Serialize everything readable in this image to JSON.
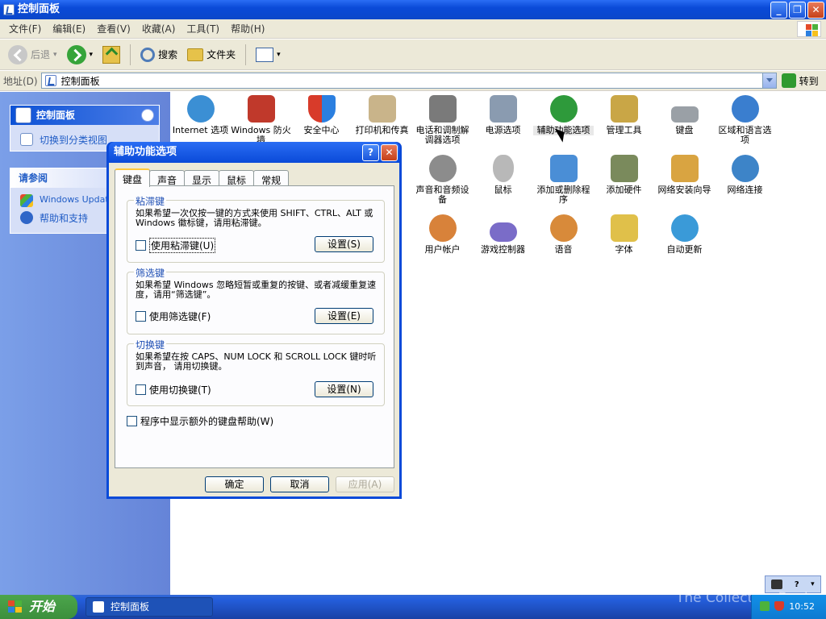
{
  "window": {
    "title": "控制面板"
  },
  "menu": [
    "文件(F)",
    "编辑(E)",
    "查看(V)",
    "收藏(A)",
    "工具(T)",
    "帮助(H)"
  ],
  "toolbar": {
    "back": "后退",
    "search": "搜索",
    "folders": "文件夹"
  },
  "address": {
    "label": "地址(D)",
    "value": "控制面板",
    "go": "转到"
  },
  "sidebar": {
    "panel1": {
      "title": "控制面板",
      "link": "切换到分类视图"
    },
    "panel2": {
      "title": "请参阅",
      "links": [
        "Windows Update",
        "帮助和支持"
      ]
    }
  },
  "icons": [
    {
      "label": "Internet 选项",
      "color": "#3b8fd4"
    },
    {
      "label": "Windows 防火墙",
      "color": "#c0392b"
    },
    {
      "label": "安全中心",
      "color": "#d83b2a"
    },
    {
      "label": "打印机和传真",
      "color": "#c9b48a"
    },
    {
      "label": "电话和调制解调器选项",
      "color": "#7a7a7a"
    },
    {
      "label": "电源选项",
      "color": "#8a9bb0"
    },
    {
      "label": "辅助功能选项",
      "color": "#2e9a3b"
    },
    {
      "label": "管理工具",
      "color": "#c9a646"
    },
    {
      "label": "键盘",
      "color": "#9aa0a6"
    },
    {
      "label": "区域和语言选项",
      "color": "#3a7ecf"
    },
    {
      "label": "声音和音频设备",
      "color": "#8c8c8c"
    },
    {
      "label": "鼠标",
      "color": "#b8b8b8"
    },
    {
      "label": "添加或删除程序",
      "color": "#4a8ed6"
    },
    {
      "label": "添加硬件",
      "color": "#7a8a5c"
    },
    {
      "label": "网络安装向导",
      "color": "#d9a441"
    },
    {
      "label": "网络连接",
      "color": "#3d84c8"
    },
    {
      "label": "用户帐户",
      "color": "#d8823a"
    },
    {
      "label": "游戏控制器",
      "color": "#7a6cc8"
    },
    {
      "label": "语音",
      "color": "#d88a3a"
    },
    {
      "label": "字体",
      "color": "#e0c04a"
    },
    {
      "label": "自动更新",
      "color": "#3a9ad8"
    }
  ],
  "dialog": {
    "title": "辅助功能选项",
    "tabs": [
      "键盘",
      "声音",
      "显示",
      "鼠标",
      "常规"
    ],
    "groups": [
      {
        "title": "粘滞键",
        "text": "如果希望一次仅按一键的方式来使用 SHIFT、CTRL、ALT 或 Windows 徽标键，请用粘滞键。",
        "check": "使用粘滞键(U)",
        "button": "设置(S)"
      },
      {
        "title": "筛选键",
        "text": "如果希望 Windows 忽略短暂或重复的按键、或者减缓重复速度，请用“筛选键”。",
        "check": "使用筛选键(F)",
        "button": "设置(E)"
      },
      {
        "title": "切换键",
        "text": "如果希望在按 CAPS、NUM LOCK 和 SCROLL LOCK 键时听到声音， 请用切换键。",
        "check": "使用切换键(T)",
        "button": "设置(N)"
      }
    ],
    "extra_check": "程序中显示额外的键盘帮助(W)",
    "ok": "确定",
    "cancel": "取消",
    "apply": "应用(A)"
  },
  "taskbar": {
    "start": "开始",
    "task": "控制面板",
    "clock": "10:52"
  },
  "watermark": "The Collection Book"
}
